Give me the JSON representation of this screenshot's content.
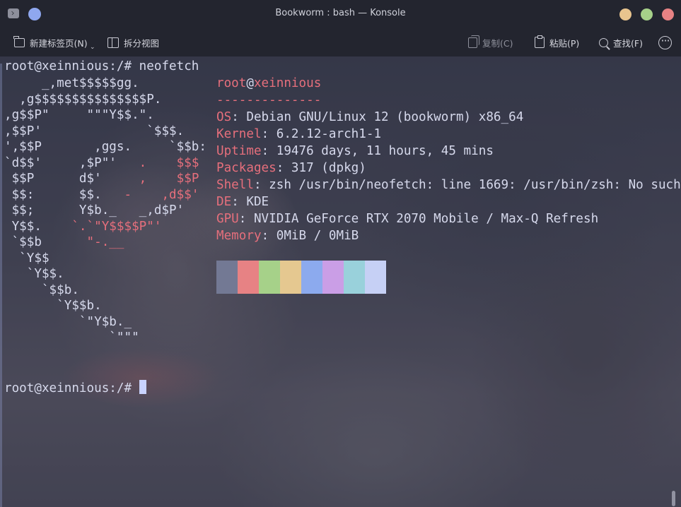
{
  "window": {
    "title": "Bookworm : bash — Konsole",
    "controls": {
      "minimize_color": "#e8c48e",
      "maximize_color": "#a6d189",
      "close_color": "#e78284"
    }
  },
  "toolbar": {
    "new_tab": "新建标签页(N)",
    "split_view": "拆分视图",
    "copy": "复制(C)",
    "paste": "粘贴(P)",
    "find": "查找(F)"
  },
  "terminal": {
    "prompt1": "root@xeinnious:/# neofetch",
    "ascii": [
      "     _,met$$$$$gg.",
      "  ,g$$$$$$$$$$$$$$$P.",
      ",g$$P\"     \"\"\"Y$$.\".",
      ",$$P'              `$$$.",
      "',$$P       ,ggs.     `$$b:",
      "`d$$'     ,$P\"'   ",
      " $$P      d$'     ",
      " $$:      $$.   ",
      " $$;      Y$b._   _,d$P'",
      " Y$$.    ",
      " `$$b      ",
      "  `Y$$",
      "   `Y$$.",
      "     `$$b.",
      "       `Y$$b.",
      "          `\"Y$b._",
      "              `\"\"\""
    ],
    "ascii_tails": [
      "",
      "",
      "",
      "",
      "",
      ".    $$$",
      ",    $$P",
      "-    ,d$$'",
      "",
      "`.`\"Y$$$$P\"'",
      "\"-.__",
      "",
      "",
      "",
      "",
      "",
      ""
    ],
    "user": "root",
    "at": "@",
    "host": "xeinnious",
    "separator": "--------------",
    "info": [
      {
        "label": "OS",
        "value": ": Debian GNU/Linux 12 (bookworm) x86_64"
      },
      {
        "label": "Kernel",
        "value": ": 6.2.12-arch1-1"
      },
      {
        "label": "Uptime",
        "value": ": 19476 days, 11 hours, 45 mins"
      },
      {
        "label": "Packages",
        "value": ": 317 (dpkg)"
      },
      {
        "label": "Shell",
        "value": ": zsh /usr/bin/neofetch: line 1669: /usr/bin/zsh: No such"
      },
      {
        "label": "DE",
        "value": ": KDE"
      },
      {
        "label": "GPU",
        "value": ": NVIDIA GeForce RTX 2070 Mobile / Max-Q Refresh"
      },
      {
        "label": "Memory",
        "value": ": 0MiB / 0MiB"
      }
    ],
    "palette": [
      "#737994",
      "#e78284",
      "#a6d189",
      "#e5c890",
      "#8caaee",
      "#ca9ee6",
      "#99d1db",
      "#c6d0f5"
    ],
    "prompt2": "root@xeinnious:/# "
  }
}
